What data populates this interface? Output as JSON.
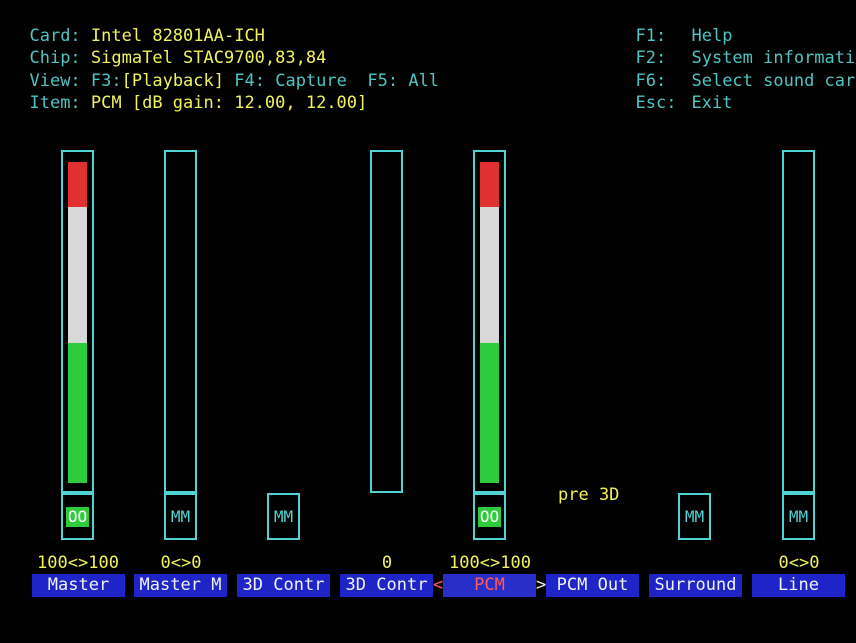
{
  "header": {
    "card_label": "Card:",
    "card_value": "Intel 82801AA-ICH",
    "chip_label": "Chip:",
    "chip_value": "SigmaTel STAC9700,83,84",
    "view_label": "View:",
    "view_f3": "F3:",
    "view_playback": "[Playback]",
    "view_f4": "F4:",
    "view_capture": "Capture",
    "view_f5": "F5:",
    "view_all": "All",
    "item_label": "Item:",
    "item_value": "PCM [dB gain: 12.00, 12.00]"
  },
  "keys": [
    {
      "key": "F1:",
      "action": "Help"
    },
    {
      "key": "F2:",
      "action": "System informati"
    },
    {
      "key": "F6:",
      "action": "Select sound car"
    },
    {
      "key": "Esc:",
      "action": "Exit"
    }
  ],
  "controls": [
    {
      "label": "Master",
      "value": "100<>100",
      "level": 1.0,
      "mute": "OO",
      "unmuted": true
    },
    {
      "label": "Master M",
      "value": "0<>0",
      "level": 0.0,
      "mute": "MM",
      "unmuted": false
    },
    {
      "label": "3D Contr",
      "value": "",
      "mute": "MM",
      "unmuted": false
    },
    {
      "label": "3D Contr",
      "value": "0",
      "level": 0.0
    },
    {
      "label": "PCM",
      "value": "100<>100",
      "level": 1.0,
      "mute": "OO",
      "unmuted": true,
      "active": true
    },
    {
      "label": "PCM Out",
      "value": ""
    },
    {
      "label": "Surround",
      "value": "",
      "mute": "MM",
      "unmuted": false
    },
    {
      "label": "Line",
      "value": "0<>0",
      "level": 0.0,
      "mute": "MM",
      "unmuted": false
    }
  ],
  "pre3d_text": "pre 3D",
  "arrow_left": "<",
  "arrow_right": ">",
  "colors": {
    "background": "#000000",
    "header_label": "#4fc4c4",
    "header_value": "#f2f25c",
    "frame": "#4fd3d3",
    "label_bg": "#1f24c8",
    "active_label": "#ff5a5a",
    "level_green": "#2ecc3a",
    "level_white": "#d8d8d8",
    "level_red": "#e03030"
  }
}
